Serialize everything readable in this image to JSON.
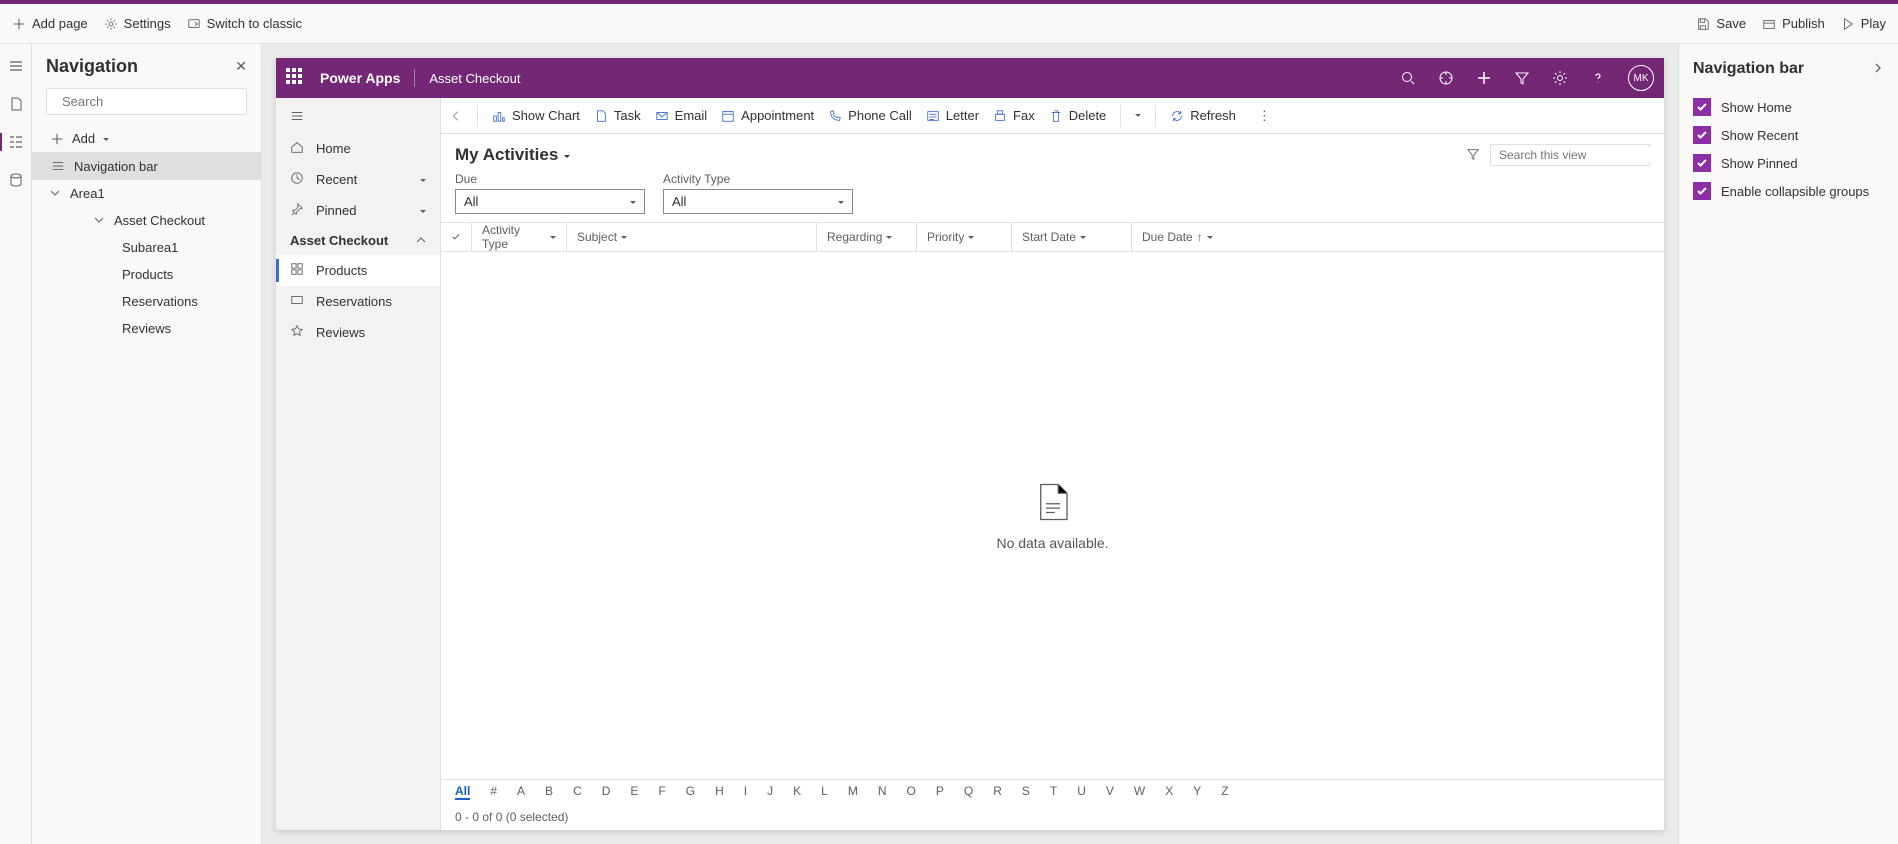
{
  "topbar": {
    "add_page": "Add page",
    "settings": "Settings",
    "switch_classic": "Switch to classic",
    "save": "Save",
    "publish": "Publish",
    "play": "Play"
  },
  "nav_panel": {
    "title": "Navigation",
    "search_placeholder": "Search",
    "add_label": "Add",
    "items": {
      "navbar": "Navigation bar",
      "area1": "Area1",
      "asset_checkout": "Asset Checkout",
      "subarea1": "Subarea1",
      "products": "Products",
      "reservations": "Reservations",
      "reviews": "Reviews"
    }
  },
  "app_header": {
    "brand": "Power Apps",
    "appname": "Asset Checkout",
    "avatar": "MK"
  },
  "sitemap": {
    "home": "Home",
    "recent": "Recent",
    "pinned": "Pinned",
    "group": "Asset Checkout",
    "products": "Products",
    "reservations": "Reservations",
    "reviews": "Reviews"
  },
  "commandbar": {
    "show_chart": "Show Chart",
    "task": "Task",
    "email": "Email",
    "appointment": "Appointment",
    "phone_call": "Phone Call",
    "letter": "Letter",
    "fax": "Fax",
    "delete": "Delete",
    "refresh": "Refresh"
  },
  "view": {
    "title": "My Activities",
    "search_placeholder": "Search this view",
    "due_label": "Due",
    "due_value": "All",
    "activity_type_label": "Activity Type",
    "activity_type_value": "All",
    "columns": {
      "activity_type": "Activity Type",
      "subject": "Subject",
      "regarding": "Regarding",
      "priority": "Priority",
      "start_date": "Start Date",
      "due_date": "Due Date"
    },
    "empty": "No data available.",
    "alpha": [
      "All",
      "#",
      "A",
      "B",
      "C",
      "D",
      "E",
      "F",
      "G",
      "H",
      "I",
      "J",
      "K",
      "L",
      "M",
      "N",
      "O",
      "P",
      "Q",
      "R",
      "S",
      "T",
      "U",
      "V",
      "W",
      "X",
      "Y",
      "Z"
    ],
    "status": "0 - 0 of 0 (0 selected)"
  },
  "prop_panel": {
    "title": "Navigation bar",
    "show_home": "Show Home",
    "show_recent": "Show Recent",
    "show_pinned": "Show Pinned",
    "enable_collapsible": "Enable collapsible groups"
  }
}
